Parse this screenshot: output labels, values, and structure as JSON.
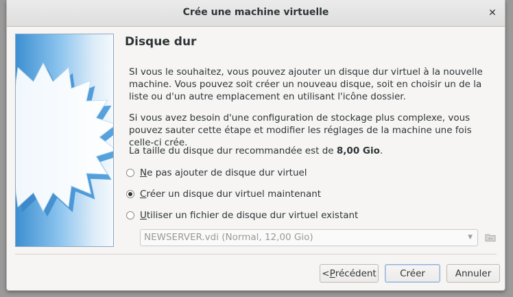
{
  "window": {
    "title": "Crée une machine virtuelle",
    "close_glyph": "✕"
  },
  "page": {
    "heading": "Disque dur",
    "paragraph1": "SI vous le souhaitez, vous pouvez ajouter un disque dur virtuel à la nouvelle machine. Vous pouvez soit créer un nouveau disque, soit en choisir un de la liste ou d'un autre emplacement en utilisant l'icône dossier.",
    "paragraph2": "Si vous avez besoin d'une configuration de stockage plus complexe, vous pouvez sauter cette étape et modifier les réglages de la machine une fois celle-ci crée.",
    "recommended_prefix": "La taille du disque dur recommandée est de ",
    "recommended_size": "8,00 Gio",
    "recommended_suffix": "."
  },
  "options": [
    {
      "mnemonic": "N",
      "rest": "e pas ajouter de disque dur virtuel",
      "checked": false
    },
    {
      "mnemonic": "C",
      "rest": "réer un disque dur virtuel maintenant",
      "checked": true
    },
    {
      "mnemonic": "U",
      "rest": "tiliser un fichier de disque dur virtuel existant",
      "checked": false
    }
  ],
  "existing_disk": {
    "selected": "NEWSERVER.vdi (Normal, 12,00 Gio)",
    "folder_icon": "folder-icon"
  },
  "buttons": {
    "prev_prefix": "< ",
    "prev_mnemonic": "P",
    "prev_rest": "récédent",
    "create": "Créer",
    "cancel": "Annuler"
  }
}
